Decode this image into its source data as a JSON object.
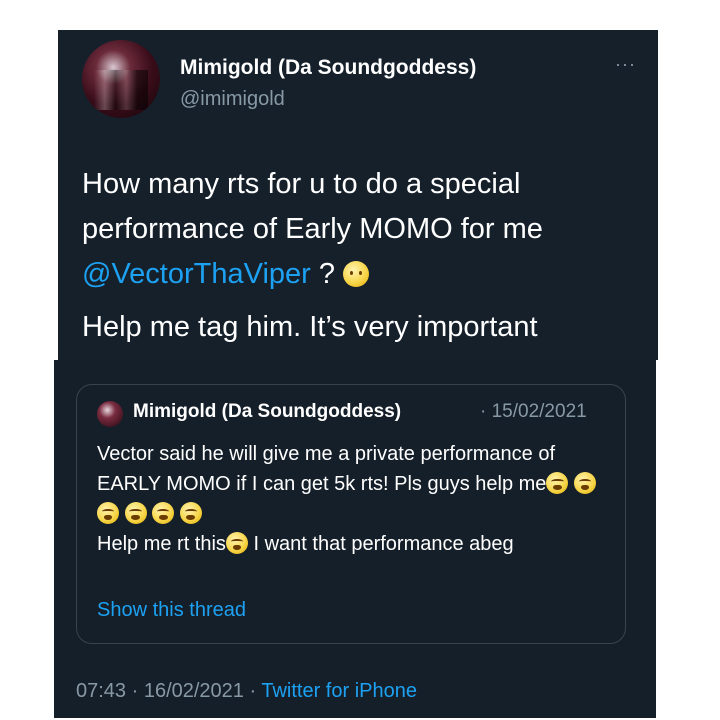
{
  "tweet": {
    "display_name": "Mimigold (Da Soundgoddess)",
    "handle": "@imimigold",
    "more": "···",
    "body_line1": "How many rts for u to do a special performance of Early MOMO for me",
    "mention": "@VectorThaViper",
    "after_mention": " ? ",
    "body_line2": "Help me tag him. It’s very important"
  },
  "quoted": {
    "display_name": "Mimigold (Da Soundgoddess)",
    "date": "· 15/02/2021",
    "text_part1": "Vector said he will give me a private performance of EARLY MOMO if I can get 5k rts! Pls guys help me",
    "text_part2": "Help me rt this",
    "text_part3": " I want that performance abeg",
    "show_thread": "Show this thread"
  },
  "footer": {
    "time_date": "07:43 · 16/02/2021 · ",
    "source": "Twitter for iPhone"
  },
  "icons": {
    "more": "more-horizontal-icon",
    "emoji_main": "slightly-frowning-face-emoji",
    "emoji_quote": "weary-face-emoji"
  },
  "colors": {
    "background": "#15202b",
    "text": "#ffffff",
    "secondary": "#8899a6",
    "link": "#1da1f2",
    "border": "#38444d"
  }
}
